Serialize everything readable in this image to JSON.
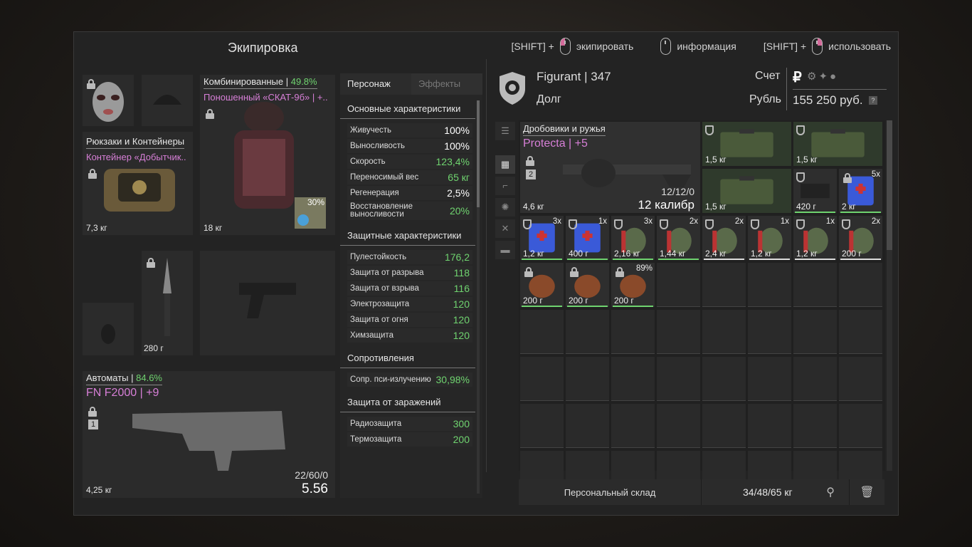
{
  "window": {
    "title": "Экипировка"
  },
  "hints": [
    {
      "key": "[SHIFT] +",
      "action": "экипировать"
    },
    {
      "key": "",
      "action": "информация"
    },
    {
      "key": "[SHIFT] +",
      "action": "использовать"
    }
  ],
  "equipment": {
    "backpack": {
      "category": "Рюкзаки и Контейнеры",
      "name": "Контейнер «Добытчик..",
      "weight": "7,3 кг"
    },
    "armor": {
      "category": "Комбинированные",
      "category_pct": "49.8%",
      "name": "Поношенный «СКАТ-9б» | +..",
      "weight": "18 кг",
      "extra_pct": "30%"
    },
    "knife": {
      "weight": "280 г"
    },
    "weapon": {
      "category": "Автоматы",
      "category_pct": "84.6%",
      "name": "FN F2000 | +9",
      "slot_no": "1",
      "weight": "4,25 кг",
      "ammo": "22/60/0",
      "caliber": "5.56"
    }
  },
  "stats": {
    "tab_active": "Персонаж",
    "tab_inactive": "Эффекты",
    "sections": [
      {
        "title": "Основные характеристики",
        "rows": [
          {
            "k": "Живучесть",
            "v": "100%",
            "c": "#ffffff"
          },
          {
            "k": "Выносливость",
            "v": "100%",
            "c": "#ffffff"
          },
          {
            "k": "Скорость",
            "v": "123,4%",
            "c": "#6fd36f"
          },
          {
            "k": "Переносимый вес",
            "v": "65 кг",
            "c": "#6fd36f"
          },
          {
            "k": "Регенерация",
            "v": "2,5%",
            "c": "#ffffff"
          },
          {
            "k": "Восстановление выносливости",
            "v": "20%",
            "c": "#6fd36f"
          }
        ]
      },
      {
        "title": "Защитные характеристики",
        "rows": [
          {
            "k": "Пулестойкость",
            "v": "176,2",
            "c": "#6fd36f"
          },
          {
            "k": "Защита от разрыва",
            "v": "118",
            "c": "#6fd36f"
          },
          {
            "k": "Защита от взрыва",
            "v": "116",
            "c": "#6fd36f"
          },
          {
            "k": "Электрозащита",
            "v": "120",
            "c": "#6fd36f"
          },
          {
            "k": "Защита от огня",
            "v": "120",
            "c": "#6fd36f"
          },
          {
            "k": "Химзащита",
            "v": "120",
            "c": "#6fd36f"
          }
        ]
      },
      {
        "title": "Сопротивления",
        "rows": [
          {
            "k": "Сопр. пси-излучению",
            "v": "30,98%",
            "c": "#6fd36f"
          }
        ]
      },
      {
        "title": "Защита от заражений",
        "rows": [
          {
            "k": "Радиозащита",
            "v": "300",
            "c": "#6fd36f"
          },
          {
            "k": "Термозащита",
            "v": "200",
            "c": "#6fd36f"
          }
        ]
      }
    ]
  },
  "player": {
    "name": "Figurant",
    "level": "347",
    "debt_label": "Долг",
    "account_label": "Счет",
    "currency_label": "Рубль",
    "money": "155 250 руб.",
    "help": "?"
  },
  "inventory": {
    "feature": {
      "category": "Дробовики и ружья",
      "name": "Protecta | +5",
      "slot_no": "2",
      "ammo": "12/12/0",
      "caliber": "12 калибр",
      "weight": "4,6 кг"
    },
    "items": [
      {
        "w": "1,5 кг",
        "cnt": ""
      },
      {
        "w": "1,5 кг",
        "cnt": ""
      },
      {
        "w": "1,5 кг",
        "cnt": ""
      },
      {
        "w": "420 г",
        "cnt": ""
      },
      {
        "w": "2 кг",
        "cnt": "5x"
      },
      {
        "w": "1,2 кг",
        "cnt": "3x"
      },
      {
        "w": "400 г",
        "cnt": "1x"
      },
      {
        "w": "2,16 кг",
        "cnt": "3x"
      },
      {
        "w": "1,44 кг",
        "cnt": "2x"
      },
      {
        "w": "2,4 кг",
        "cnt": "2x"
      },
      {
        "w": "1,2 кг",
        "cnt": "1x"
      },
      {
        "w": "1,2 кг",
        "cnt": "1x"
      },
      {
        "w": "200 г",
        "cnt": "2x"
      },
      {
        "w": "200 г",
        "cnt": ""
      },
      {
        "w": "200 г",
        "cnt": ""
      },
      {
        "w": "200 г",
        "cnt": "89%"
      }
    ]
  },
  "footer": {
    "storage_label": "Персональный склад",
    "weight": "34/48/65 кг"
  }
}
